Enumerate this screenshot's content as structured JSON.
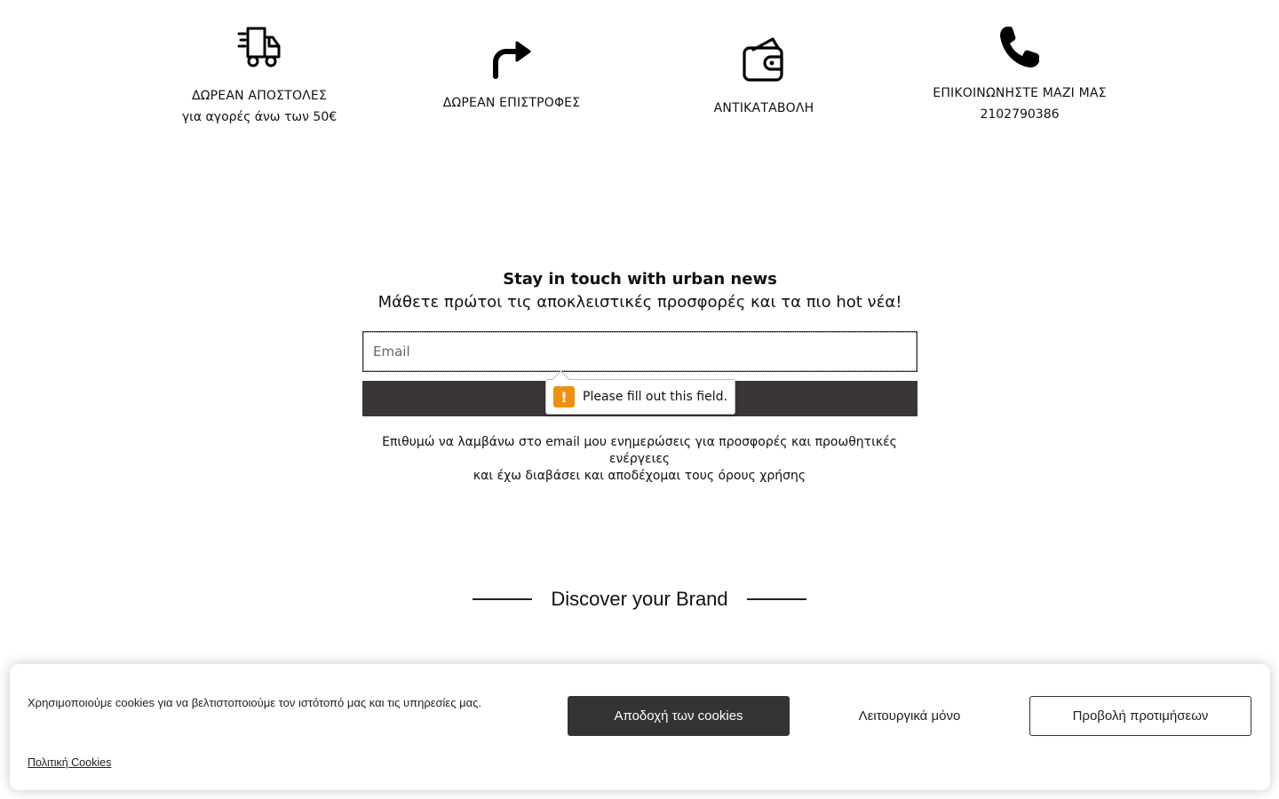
{
  "features": [
    {
      "icon": "delivery-truck-icon",
      "title": "ΔΩΡΕΑΝ ΑΠΟΣΤΟΛΕΣ",
      "subtitle": "για αγορές άνω των 50€"
    },
    {
      "icon": "return-arrow-icon",
      "title": "ΔΩΡΕΑΝ ΕΠΙΣΤΡΟΦΕΣ",
      "subtitle": ""
    },
    {
      "icon": "wallet-icon",
      "title": "ΑΝΤΙΚΑΤΑΒΟΛΗ",
      "subtitle": ""
    },
    {
      "icon": "phone-icon",
      "title": "ΕΠΙΚΟΙΝΩΝΗΣΤΕ ΜΑΖΙ ΜΑΣ",
      "subtitle": "2102790386"
    }
  ],
  "newsletter": {
    "title": "Stay in touch with urban news",
    "subtitle": "Μάθετε πρώτοι τις αποκλειστικές προσφορές και τα πιο hot νέα!",
    "email_placeholder": "Email",
    "email_value": "",
    "submit_label": "",
    "validation_message": "Please fill out this field.",
    "consent_line1": "Επιθυμώ να λαμβάνω στο email μου ενημερώσεις για προσφορές και προωθητικές ενέργειες",
    "consent_line2": "και έχω διαβάσει και αποδέχομαι τους όρους χρήσης"
  },
  "discover": {
    "title": "Discover your Brand"
  },
  "cookie_banner": {
    "message": "Χρησιμοποιούμε cookies για να βελτιστοποιούμε τον ιστότοπό μας και τις υπηρεσίες μας.",
    "accept_label": "Αποδοχή των cookies",
    "functional_label": "Λειτουργικά μόνο",
    "preferences_label": "Προβολή προτιμήσεων",
    "policy_link": "Πολιτική Cookies"
  },
  "colors": {
    "button_dark": "#3a3636",
    "accept_dark": "#333333",
    "warning": "#f0900f"
  }
}
